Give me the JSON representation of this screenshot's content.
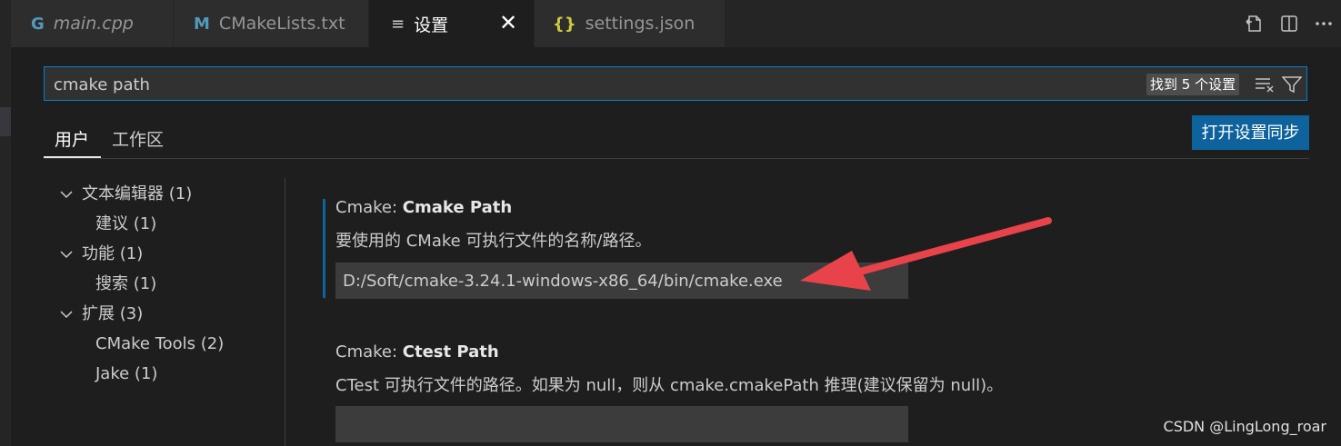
{
  "tabs": [
    {
      "label": "main.cpp",
      "icon": "cpp-file-icon",
      "icon_glyph": "G",
      "icon_color": "#519aba",
      "italic": true,
      "active": false
    },
    {
      "label": "CMakeLists.txt",
      "icon": "markdown-m-icon",
      "icon_glyph": "M",
      "icon_color": "#519aba",
      "italic": false,
      "active": false
    },
    {
      "label": "设置",
      "icon": "settings-document-icon",
      "icon_glyph": "≡",
      "icon_color": "#cccccc",
      "italic": false,
      "active": true
    },
    {
      "label": "settings.json",
      "icon": "json-braces-icon",
      "icon_glyph": "{}",
      "icon_color": "#cbcb41",
      "italic": false,
      "active": false
    }
  ],
  "tab_close_glyph": "✕",
  "search": {
    "value": "cmake path",
    "result_count": "找到 5 个设置"
  },
  "scope_tabs": {
    "user": "用户",
    "workspace": "工作区"
  },
  "sync_button": "打开设置同步",
  "toc": [
    {
      "label": "文本编辑器 (1)",
      "expanded": true,
      "level": 0
    },
    {
      "label": "建议 (1)",
      "level": 1
    },
    {
      "label": "功能 (1)",
      "expanded": true,
      "level": 0
    },
    {
      "label": "搜索 (1)",
      "level": 1
    },
    {
      "label": "扩展 (3)",
      "expanded": true,
      "level": 0
    },
    {
      "label": "CMake Tools (2)",
      "level": 1
    },
    {
      "label": "Jake (1)",
      "level": 1
    }
  ],
  "settings": [
    {
      "category": "Cmake: ",
      "name": "Cmake Path",
      "description": "要使用的 CMake 可执行文件的名称/路径。",
      "value": "D:/Soft/cmake-3.24.1-windows-x86_64/bin/cmake.exe",
      "focused": true
    },
    {
      "category": "Cmake: ",
      "name": "Ctest Path",
      "description": "CTest 可执行文件的路径。如果为 null，则从 cmake.cmakePath 推理(建议保留为 null)。",
      "value": "",
      "focused": false
    }
  ],
  "annotation_arrow_color": "#e8434a",
  "accent_color": "#0e639c",
  "watermark": "CSDN @LingLong_roar"
}
